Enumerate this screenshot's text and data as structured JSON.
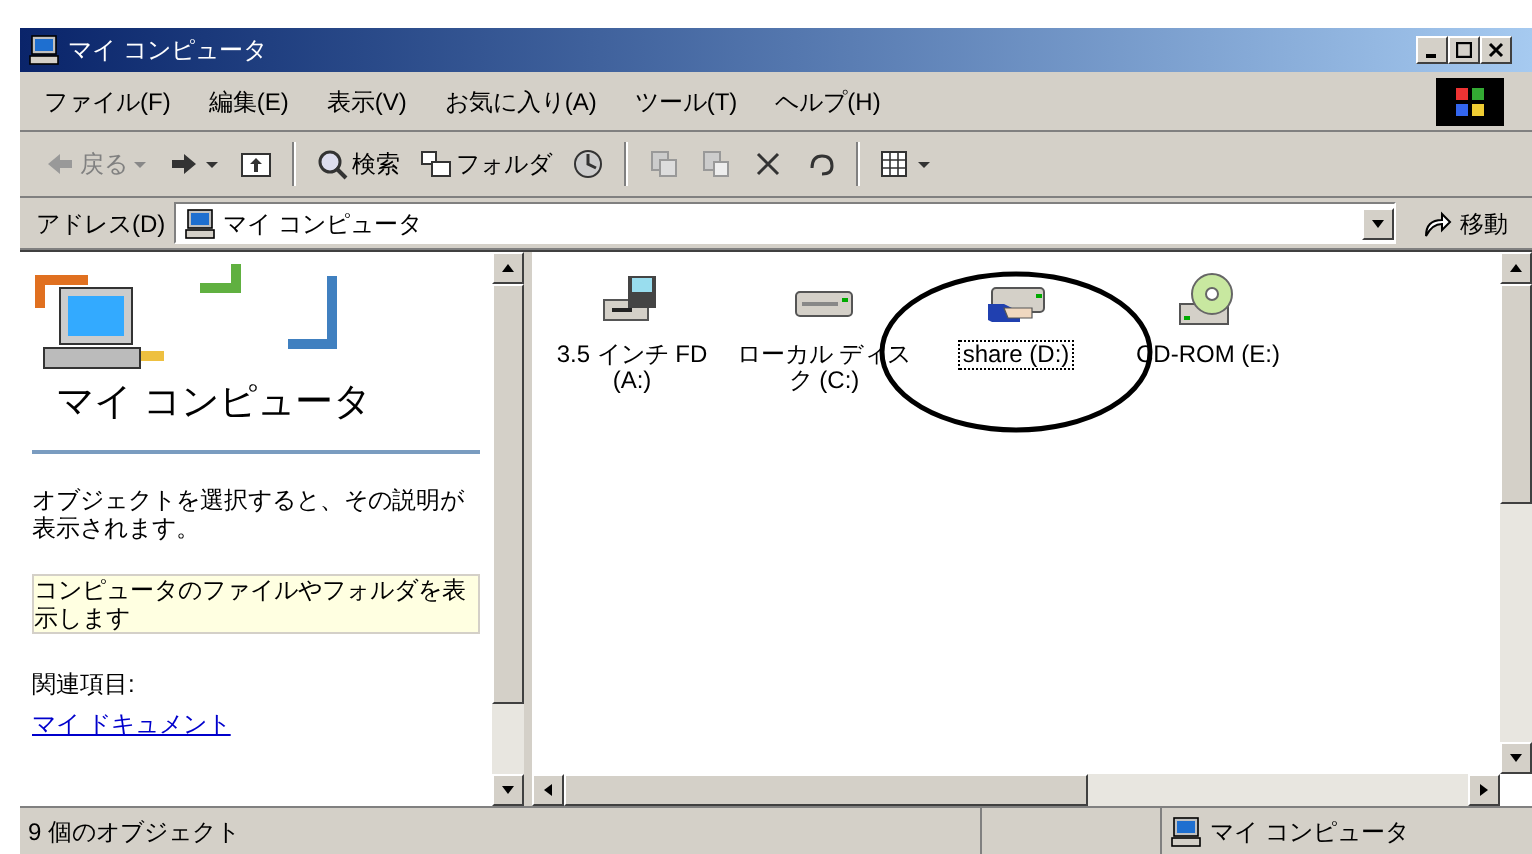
{
  "window": {
    "title": "マイ コンピュータ"
  },
  "menu": [
    "ファイル(F)",
    "編集(E)",
    "表示(V)",
    "お気に入り(A)",
    "ツール(T)",
    "ヘルプ(H)"
  ],
  "toolbar": [
    {
      "kind": "back",
      "label": "戻る",
      "disabled": true
    },
    {
      "kind": "forward",
      "disabled": false
    },
    {
      "kind": "up",
      "disabled": false
    },
    {
      "kind": "search",
      "label": "検索",
      "disabled": false
    },
    {
      "kind": "folders",
      "label": "フォルダ",
      "disabled": false
    },
    {
      "kind": "history",
      "disabled": false
    },
    {
      "kind": "move",
      "disabled": true
    },
    {
      "kind": "copy",
      "disabled": true
    },
    {
      "kind": "delete",
      "disabled": false
    },
    {
      "kind": "undo",
      "disabled": false
    },
    {
      "kind": "views",
      "disabled": false
    }
  ],
  "address": {
    "label": "アドレス(D)",
    "value": "マイ コンピュータ",
    "go": "移動"
  },
  "sidebar": {
    "title": "マイ コンピュータ",
    "description": "オブジェクトを選択すると、その説明が表示されます。",
    "tip": "コンピュータのファイルやフォルダを表示します",
    "related_heading": "関連項目:",
    "links": [
      "マイ ドキュメント"
    ]
  },
  "drives": [
    {
      "kind": "floppy",
      "label": "3.5 インチ FD (A:)",
      "selected": false
    },
    {
      "kind": "hdd",
      "label": "ローカル ディスク (C:)",
      "selected": false
    },
    {
      "kind": "share",
      "label": "share (D:)",
      "selected": true
    },
    {
      "kind": "cdrom",
      "label": "CD-ROM (E:)",
      "selected": false
    }
  ],
  "status_bar": {
    "count": "9 個のオブジェクト",
    "zone": "マイ コンピュータ"
  }
}
